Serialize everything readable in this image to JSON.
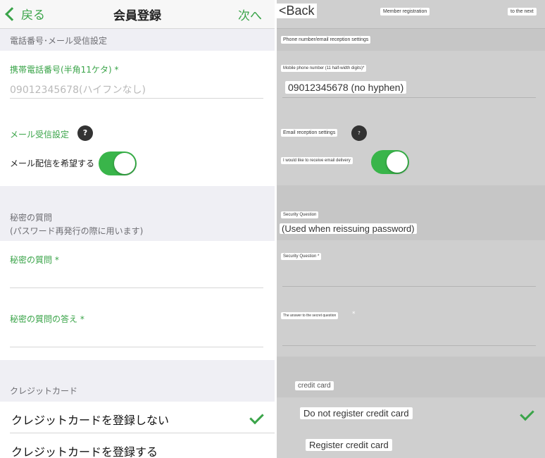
{
  "ja": {
    "nav": {
      "back": "戻る",
      "title": "会員登録",
      "next": "次へ"
    },
    "phone_section_header": "電話番号･メール受信設定",
    "phone_label": "携帯電話番号(半角11ケタ)",
    "phone_placeholder": "09012345678(ハイフンなし)",
    "email_label": "メール受信設定",
    "help_mark": "?",
    "email_toggle_label": "メール配信を希望する",
    "email_toggle_on": true,
    "secret_header_line1": "秘密の質問",
    "secret_header_line2": "(パスワード再発行の際に用います)",
    "secret_question_label": "秘密の質問",
    "secret_answer_label": "秘密の質問の答え",
    "required_mark": "*",
    "credit_header": "クレジットカード",
    "credit_option_none": "クレジットカードを登録しない",
    "credit_option_register": "クレジットカードを登録する"
  },
  "en": {
    "back": "<Back",
    "title": "Member registration",
    "next": "to the next",
    "phone_section_header": "Phone number/email reception settings",
    "phone_label": "Mobile phone number (11 half-width digits)*",
    "phone_placeholder": "09012345678 (no hyphen)",
    "email_label": "Email reception settings",
    "help_mark": "?",
    "email_toggle_label": "I would like to receive email delivery",
    "secret_header_line1": "Security Question",
    "secret_header_line2": "(Used when reissuing password)",
    "secret_question_label": "Security Question *",
    "secret_answer_label": "The answer to the secret question",
    "required_mark": "*",
    "credit_header": "credit card",
    "credit_option_none": "Do not register credit card",
    "credit_option_register": "Register credit card"
  },
  "colors": {
    "accent": "#3aa449",
    "toggle_on": "#39b54a",
    "section_bg": "#efeff4"
  }
}
